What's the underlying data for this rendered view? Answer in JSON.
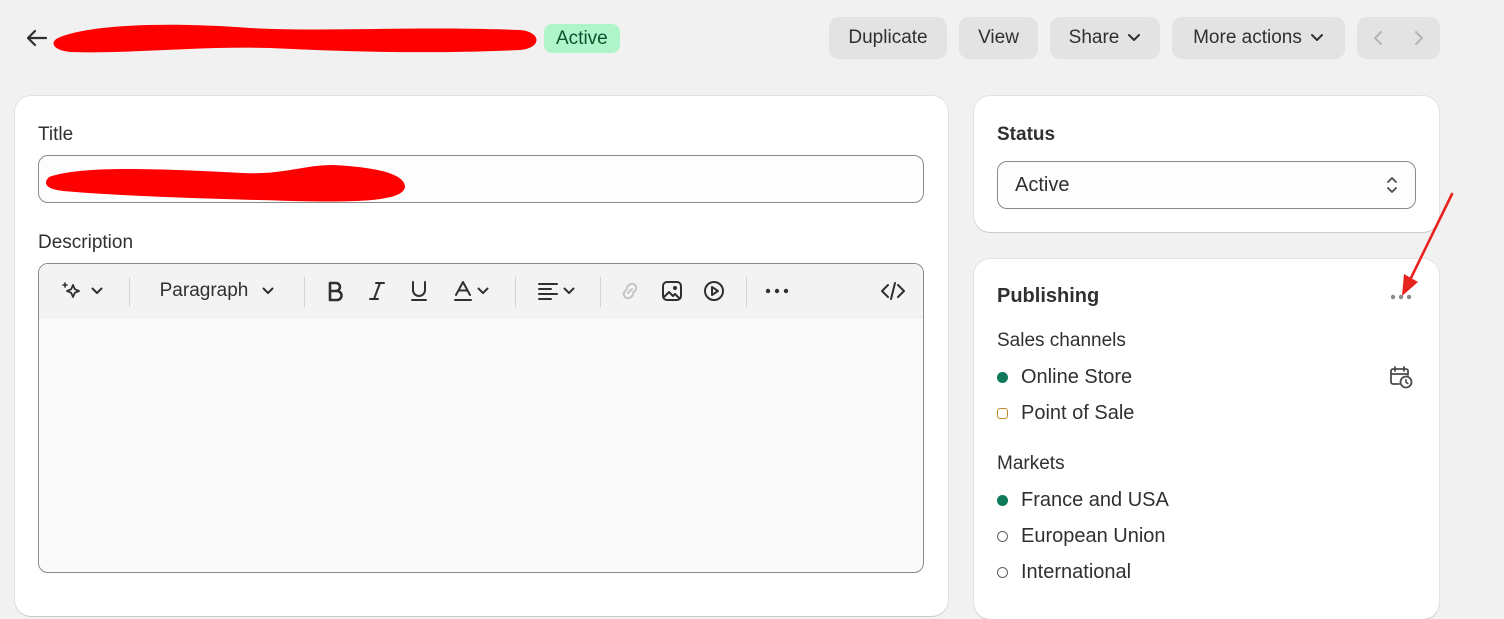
{
  "header": {
    "status_badge": "Active",
    "buttons": {
      "duplicate": "Duplicate",
      "view": "View",
      "share": "Share",
      "more_actions": "More actions"
    }
  },
  "product_card": {
    "title_label": "Title",
    "description_label": "Description",
    "toolbar": {
      "paragraph": "Paragraph"
    }
  },
  "status_card": {
    "heading": "Status",
    "selected": "Active"
  },
  "publishing_card": {
    "heading": "Publishing",
    "sales_channels_heading": "Sales channels",
    "sales_channels": [
      {
        "label": "Online Store",
        "state": "published"
      },
      {
        "label": "Point of Sale",
        "state": "unpublished"
      }
    ],
    "markets_heading": "Markets",
    "markets": [
      {
        "label": "France and USA",
        "state": "published"
      },
      {
        "label": "European Union",
        "state": "unpublished"
      },
      {
        "label": "International",
        "state": "unpublished"
      }
    ]
  },
  "colors": {
    "badge_bg": "#aff5c9",
    "badge_text": "#0c5132",
    "published_dot": "#0e7a5b",
    "annotation_arrow": "#e8231f",
    "redaction": "#ff0000"
  }
}
